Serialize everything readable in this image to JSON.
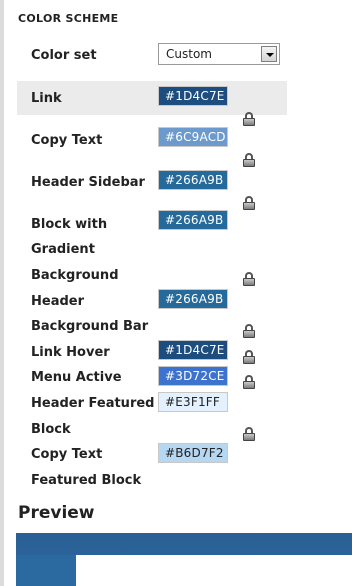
{
  "section_title": "COLOR SCHEME",
  "color_set": {
    "label": "Color set",
    "value": "Custom"
  },
  "rows": [
    {
      "label": "Link",
      "value": "#1D4C7E",
      "bg": "#1D4C7E",
      "fg": "#ffffff"
    },
    {
      "label": "Copy Text",
      "value": "#6C9ACD",
      "bg": "#6C9ACD",
      "fg": "#ffffff"
    },
    {
      "label": "Header Sidebar",
      "value": "#266A9B",
      "bg": "#266A9B",
      "fg": "#ffffff"
    },
    {
      "label_lines": [
        "Block with",
        "Gradient",
        "Background"
      ],
      "value": "#266A9B",
      "bg": "#266A9B",
      "fg": "#ffffff"
    },
    {
      "label_lines": [
        "Header",
        "Background Bar"
      ],
      "value": "#266A9B",
      "bg": "#266A9B",
      "fg": "#ffffff"
    },
    {
      "label": "Link Hover",
      "value": "#1D4C7E",
      "bg": "#1D4C7E",
      "fg": "#ffffff"
    },
    {
      "label": "Menu Active",
      "value": "#3D72CE",
      "bg": "#3D72CE",
      "fg": "#ffffff"
    },
    {
      "label_lines": [
        "Header Featured",
        "Block"
      ],
      "value": "#E3F1FF",
      "bg": "#E3F1FF",
      "fg": "#222222"
    },
    {
      "label_lines": [
        "Copy Text",
        "Featured Block"
      ],
      "value": "#B6D7F2",
      "bg": "#B6D7F2",
      "fg": "#222222"
    }
  ],
  "preview_title": "Preview"
}
